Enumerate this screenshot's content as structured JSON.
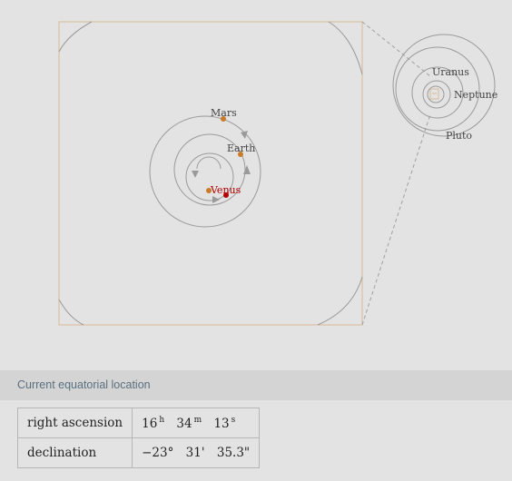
{
  "diagram": {
    "inner_planets": [
      {
        "name": "Mars",
        "highlight": false
      },
      {
        "name": "Earth",
        "highlight": false
      },
      {
        "name": "Venus",
        "highlight": true
      }
    ],
    "outer_planets": [
      {
        "name": "Uranus"
      },
      {
        "name": "Neptune"
      },
      {
        "name": "Pluto"
      }
    ],
    "colors": {
      "planet": "#c97b28",
      "highlight": "#b40000",
      "orbit": "#9a9a9a",
      "frame": "#d9b89a"
    }
  },
  "location": {
    "title": "Current equatorial location",
    "rows": [
      {
        "label": "right ascension",
        "parts": [
          {
            "value": "16",
            "unit": "h"
          },
          {
            "value": "34",
            "unit": "m"
          },
          {
            "value": "13",
            "unit": "s"
          }
        ]
      },
      {
        "label": "declination",
        "parts": [
          {
            "value": "−23°",
            "unit": ""
          },
          {
            "value": "31'",
            "unit": ""
          },
          {
            "value": "35.3\"",
            "unit": ""
          }
        ]
      }
    ]
  }
}
